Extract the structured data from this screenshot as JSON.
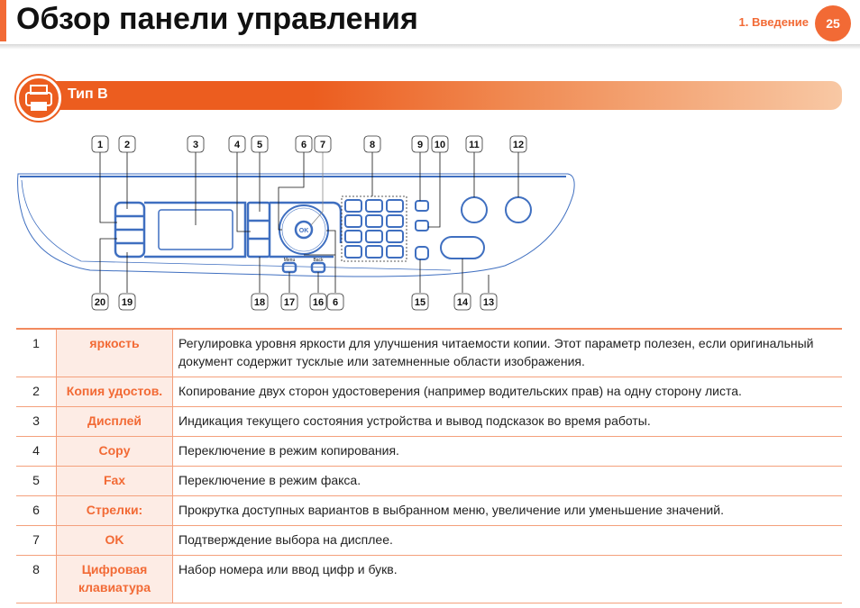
{
  "header": {
    "title": "Обзор панели управления",
    "chapter": "1.  Введение",
    "page_number": "25",
    "accent_color": "#f26a35"
  },
  "section": {
    "title": "Тип B",
    "icon": "printer-icon"
  },
  "diagram": {
    "callouts_top": [
      "1",
      "2",
      "3",
      "4",
      "5",
      "6",
      "7",
      "8",
      "9",
      "10",
      "11",
      "12"
    ],
    "callouts_bottom": [
      "20",
      "19",
      "18",
      "17",
      "16",
      "6",
      "15",
      "14",
      "13"
    ],
    "button_labels": {
      "menu": "Menu",
      "back": "Back",
      "ok": "OK"
    }
  },
  "table": {
    "rows": [
      {
        "num": "1",
        "name": "яркость",
        "text": "Регулировка уровня яркости для улучшения читаемости копии. Этот параметр полезен, если оригинальный документ содержит тусклые или затемненные области изображения."
      },
      {
        "num": "2",
        "name": "Копия удостов.",
        "text": "Копирование двух сторон удостоверения (например водительских прав) на одну сторону листа."
      },
      {
        "num": "3",
        "name": "Дисплей",
        "text": "Индикация текущего состояния устройства и вывод подсказок во время работы."
      },
      {
        "num": "4",
        "name": "Copy",
        "text": "Переключение в режим копирования."
      },
      {
        "num": "5",
        "name": "Fax",
        "text": "Переключение в режим факса."
      },
      {
        "num": "6",
        "name": "Стрелки:",
        "text": "Прокрутка доступных вариантов в выбранном меню, увеличение или уменьшение значений."
      },
      {
        "num": "7",
        "name": "OK",
        "text": "Подтверждение выбора на дисплее."
      },
      {
        "num": "8",
        "name": "Цифровая клавиатура",
        "text": "Набор номера или ввод цифр и букв."
      }
    ]
  }
}
